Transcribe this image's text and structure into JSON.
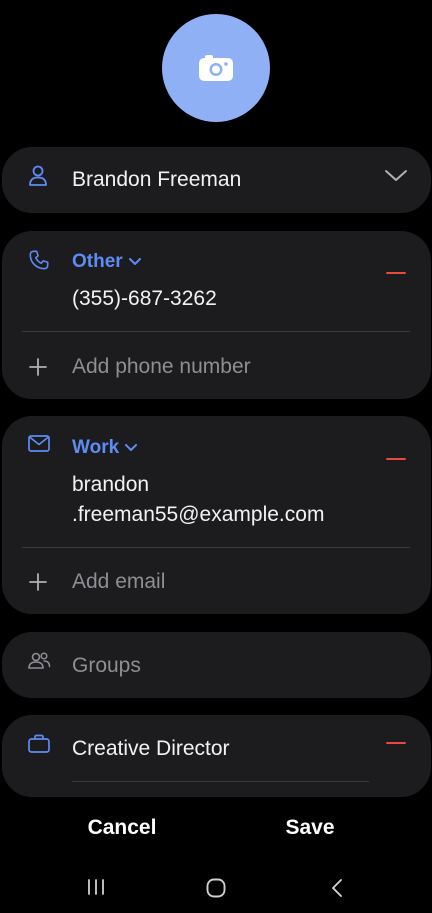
{
  "contact": {
    "name": "Brandon Freeman"
  },
  "phone": {
    "type_label": "Other",
    "number": "(355)-687-3262",
    "add_label": "Add phone number"
  },
  "email": {
    "type_label": "Work",
    "line1": "brandon",
    "line2": ".freeman55@example.com",
    "add_label": "Add email"
  },
  "groups": {
    "label": "Groups"
  },
  "job": {
    "title": "Creative Director"
  },
  "actions": {
    "cancel_label": "Cancel",
    "save_label": "Save"
  },
  "colors": {
    "accent": "#5d8cf4",
    "avatar": "#8fb0f4",
    "remove": "#e64a3f",
    "card": "#1c1c1e"
  }
}
